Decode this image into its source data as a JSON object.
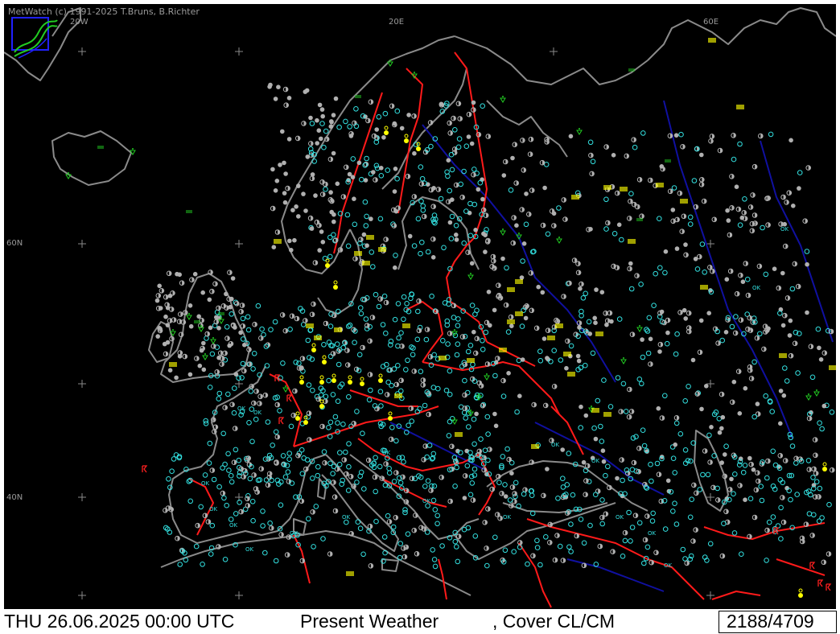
{
  "app": {
    "credit": "MetWatch  (c) 1991-2025 T.Bruns, B.Richter"
  },
  "map": {
    "grid_labels": {
      "lon_20w": "20W",
      "lon_20e": "20E",
      "lon_60e": "60E",
      "lat_60n": "60N",
      "lat_40n": "40N"
    },
    "colors": {
      "background": "#000000",
      "coastline": "#8a8a8a",
      "borders": "#ff1a1a",
      "rivers": "#1010a0",
      "obs_clear": "#33e0e0",
      "obs_partial": "#b0b0b0",
      "weather_green": "#22cc22",
      "weather_yellow": "#ffff00",
      "thunder_red": "#ff2020"
    },
    "symbol_types": [
      "station-circle",
      "station-half-circle",
      "fog-bars",
      "shower-symbol",
      "rain-dot",
      "thunderstorm-symbol",
      "ok-label"
    ],
    "ok_label": "OK"
  },
  "status": {
    "datetime": "THU 26.06.2025 00:00 UTC",
    "product": "Present Weather",
    "cover": ", Cover CL/CM",
    "station_count": "2188/4709"
  }
}
